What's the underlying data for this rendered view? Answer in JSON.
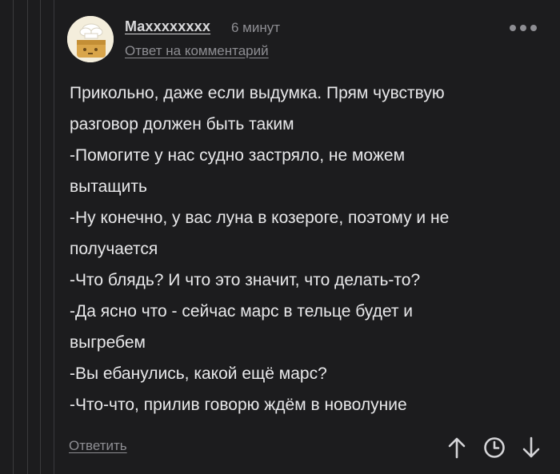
{
  "comment": {
    "author": "Maxxxxxxxx",
    "time": "6 минут",
    "reply_to": "Ответ на комментарий",
    "lines": [
      "Прикольно, даже если выдумка. Прям чувствую",
      "разговор должен быть таким",
      "-Помогите у нас судно застряло, не можем",
      "вытащить",
      "-Ну конечно, у вас луна в козероге, поэтому и не",
      "получается",
      "-Что блядь? И что это значит, что делать-то?",
      "-Да ясно что - сейчас марс в тельце будет и",
      "выгребем",
      "-Вы ебанулись, какой ещё марс?",
      "-Что-что, прилив говорю ждём в новолуние"
    ]
  },
  "actions": {
    "reply_label": "Ответить"
  },
  "icons": {
    "more": "more-dots-icon",
    "upvote": "arrow-up-icon",
    "save": "clock-icon",
    "downvote": "arrow-down-icon"
  },
  "colors": {
    "background": "#1c1c1e",
    "text": "#e8e8ea",
    "muted": "#8e8e93",
    "icon": "#d5d5d8"
  }
}
